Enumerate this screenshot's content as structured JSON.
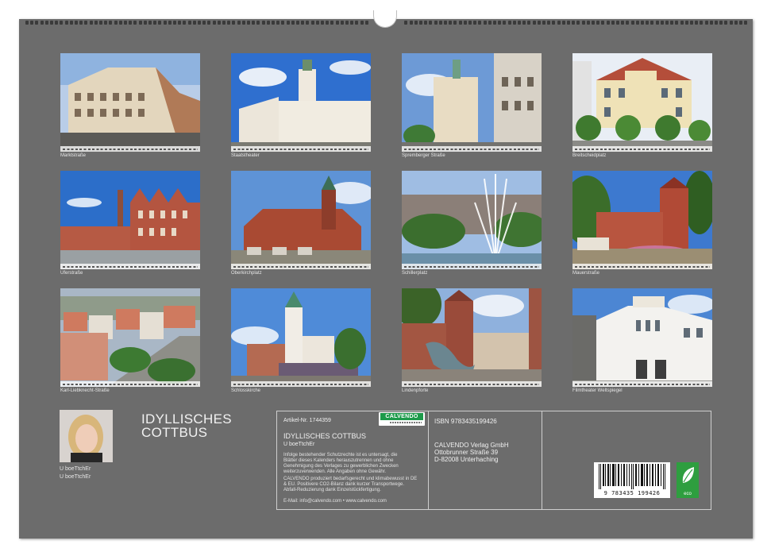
{
  "photos": [
    {
      "caption": "Marktstraße"
    },
    {
      "caption": "Staatstheater"
    },
    {
      "caption": "Spremberger Straße"
    },
    {
      "caption": "Breitscheidplatz"
    },
    {
      "caption": "Uferstraße"
    },
    {
      "caption": "Oberkirchplatz"
    },
    {
      "caption": "Schillerplatz"
    },
    {
      "caption": "Mauerstraße"
    },
    {
      "caption": "Karl-Liebknecht-Straße"
    },
    {
      "caption": "Schlosskirche"
    },
    {
      "caption": "Lindenpforte"
    },
    {
      "caption": "Filmtheater Weltspiegel"
    }
  ],
  "author": {
    "name": "U boeTtchEr",
    "name2": "U boeTtchEr"
  },
  "title": {
    "line1": "IDYLLISCHES",
    "line2": "COTTBUS"
  },
  "info": {
    "artikel": "Artikel-Nr. 1744359",
    "calendar_title": "IDYLLISCHES COTTBUS",
    "calendar_author": "U boeTtchEr",
    "notice1": "Infolge bestehender Schutzrechte ist es untersagt, die",
    "notice2": "Blätter dieses Kalenders herauszutrennen und ohne",
    "notice3": "Genehmigung des Verlages zu gewerblichen Zwecken",
    "notice4": "weiterzuverwenden. Alle Angaben ohne Gewähr.",
    "eco1": "CALVENDO produziert bedarfsgerecht und klimabewusst in DE",
    "eco2": "& EU. Positivere CO2-Bilanz dank kurzer Transportwege.",
    "eco3": "Abfall-Reduzierung dank Einzelstückfertigung.",
    "contact": "E-Mail: info@calvendo.com • www.calvendo.com",
    "isbn": "ISBN 9783435199426",
    "publisher1": "CALVENDO Verlag GmbH",
    "publisher2": "Ottobrunner Straße 39",
    "publisher3": "D-82008 Unterhaching",
    "barcode": "9 783435 199426",
    "logo": "CALVENDO",
    "eco_label": "eco"
  },
  "colors": {
    "sheet": "#6c6c6c",
    "brand_green": "#1d9a4a"
  }
}
